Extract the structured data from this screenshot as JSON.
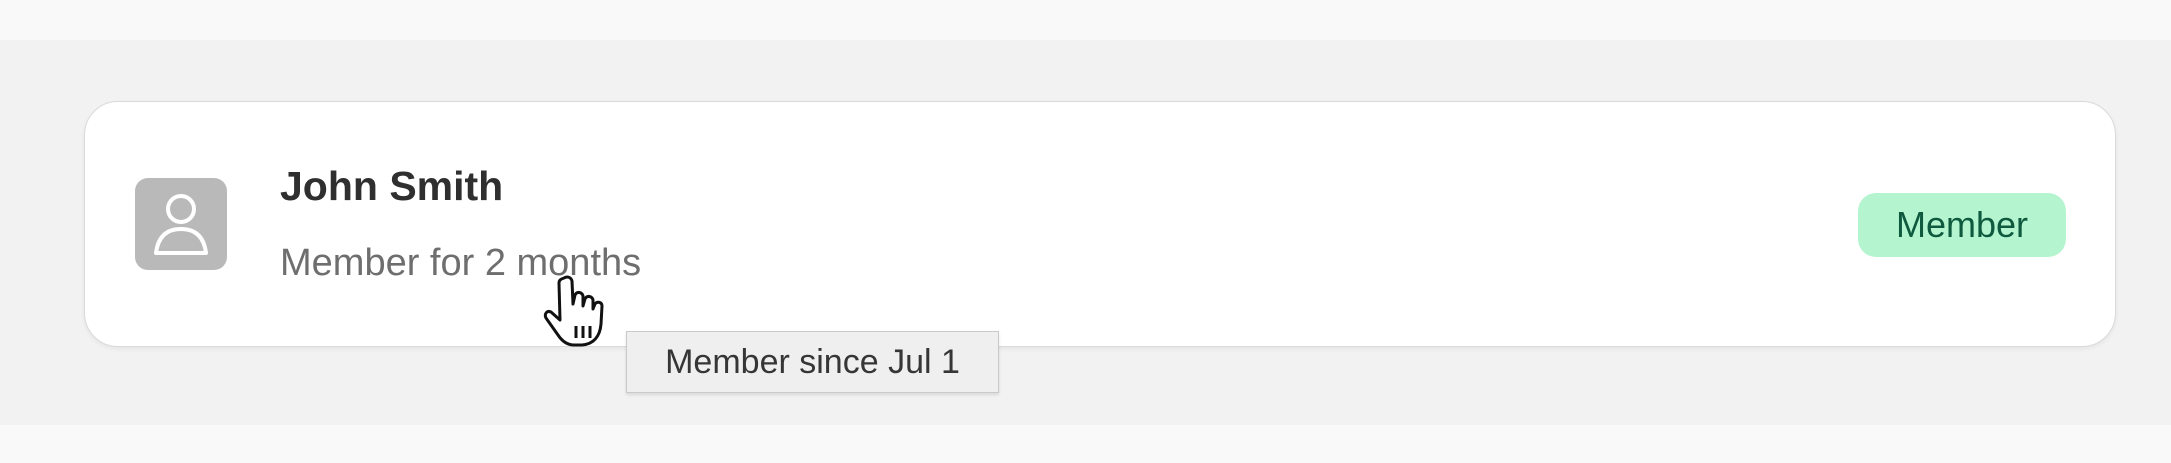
{
  "member_card": {
    "name": "John Smith",
    "tenure": "Member for 2 months",
    "badge_label": "Member",
    "tooltip": "Member since Jul 1",
    "avatar_icon": "person-icon",
    "cursor_icon": "hand-pointer-icon"
  },
  "colors": {
    "badge_background": "#b4f5d0",
    "badge_text": "#0f5a3e",
    "avatar_background": "#b9b9b9",
    "page_background": "#f2f2f2",
    "card_background": "#ffffff"
  }
}
